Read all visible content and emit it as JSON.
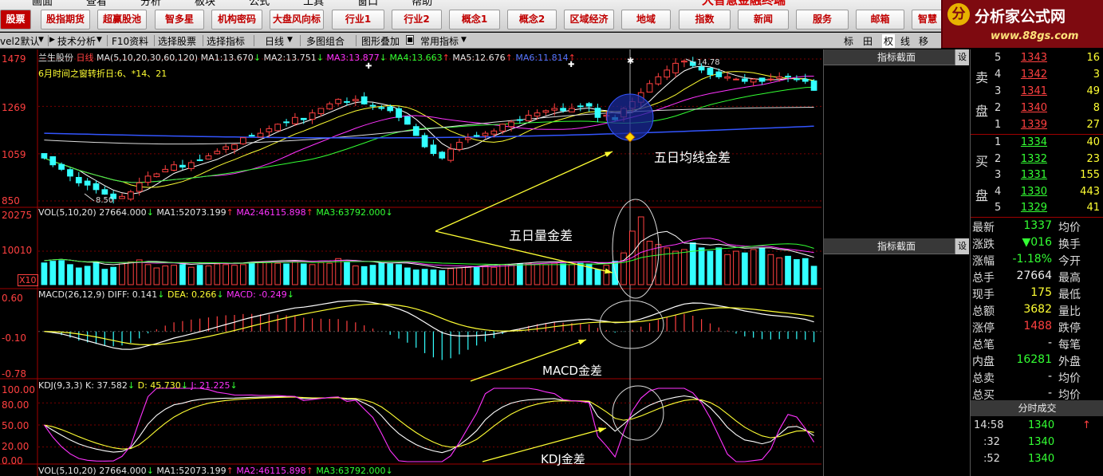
{
  "top_menu": [
    "画面",
    "查看",
    "分析",
    "板块",
    "公式",
    "工具",
    "窗口",
    "帮助"
  ],
  "banner": "大智慧金融终端",
  "top_buttons": [
    "股票",
    "股指期货",
    "超赢股池",
    "智多星",
    "机构密码",
    "大盘风向标",
    "行业1",
    "行业2",
    "概念1",
    "概念2",
    "区域经济",
    "地域",
    "指数",
    "新闻",
    "服务",
    "邮箱",
    "智慧"
  ],
  "logo": {
    "emblem": "分",
    "title": "分析家公式网",
    "url": "www.88gs.com"
  },
  "toolbar": {
    "level": "vel2默认",
    "items": [
      "技术分析",
      "F10资料",
      "选择股票",
      "选择指标",
      "日线",
      "多图组合",
      "图形叠加",
      "常用指标"
    ],
    "right_icons": [
      "标",
      "田",
      "权",
      "线",
      "移"
    ]
  },
  "price_panel": {
    "stock": "兰生股份",
    "period": "日线",
    "ma_formula": "MA(5,10,20,30,60,120)",
    "ma_values": [
      {
        "name": "MA1:",
        "value": "13.670",
        "dir": "↓"
      },
      {
        "name": "MA2:",
        "value": "13.751",
        "dir": "↓"
      },
      {
        "name": "MA3:",
        "value": "13.877",
        "dir": "↓"
      },
      {
        "name": "MA4:",
        "value": "13.663",
        "dir": "↑"
      },
      {
        "name": "MA5:",
        "value": "12.676",
        "dir": "↑"
      },
      {
        "name": "MA6:",
        "value": "11.814",
        "dir": "↑"
      }
    ],
    "turning_text": "6月时间之窗转折日:6、*14、21",
    "y_labels": [
      "1479",
      "1269",
      "1059",
      "850"
    ],
    "low_label": "8.50",
    "high_label": "14.78"
  },
  "volume_panel": {
    "formula": "VOL(5,10,20)",
    "vol_value": "27664.000",
    "ma_values": [
      {
        "name": "MA1:",
        "value": "52073.199",
        "dir": "↑"
      },
      {
        "name": "MA2:",
        "value": "46115.898",
        "dir": "↑"
      },
      {
        "name": "MA3:",
        "value": "63792.000",
        "dir": "↓"
      }
    ],
    "y_labels": [
      "20275",
      "10010",
      "X10"
    ]
  },
  "macd_panel": {
    "formula": "MACD(26,12,9)",
    "diff": "DIFF: 0.141",
    "dea": "DEA: 0.266",
    "macd": "MACD: -0.249",
    "y_labels": [
      "0.60",
      "-0.10",
      "-0.78"
    ]
  },
  "kdj_panel": {
    "formula": "KDJ(9,3,3)",
    "k": "K: 37.582",
    "d": "D: 45.730",
    "j": "J: 21.225",
    "y_labels": [
      "100.00",
      "80.00",
      "50.00",
      "20.00",
      "0.00"
    ]
  },
  "bottom_panel": {
    "formula": "VOL(5,10,20)",
    "vol_value": "27664.000",
    "ma_values": [
      {
        "name": "MA1:",
        "value": "52073.199",
        "dir": "↑"
      },
      {
        "name": "MA2:",
        "value": "46115.898",
        "dir": "↑"
      },
      {
        "name": "MA3:",
        "value": "63792.000",
        "dir": "↓"
      }
    ]
  },
  "annotations": [
    "五日均线金差",
    "五日量金差",
    "MACD金差",
    "KDJ金差"
  ],
  "indicator_panel": {
    "header": "指标截面",
    "settings": "设"
  },
  "orderbook": {
    "sell_label": [
      "卖",
      "盘"
    ],
    "buy_label": [
      "买",
      "盘"
    ],
    "sells": [
      {
        "level": "5",
        "price": "1343",
        "vol": "16"
      },
      {
        "level": "4",
        "price": "1342",
        "vol": "3"
      },
      {
        "level": "3",
        "price": "1341",
        "vol": "49"
      },
      {
        "level": "2",
        "price": "1340",
        "vol": "8"
      },
      {
        "level": "1",
        "price": "1339",
        "vol": "27"
      }
    ],
    "buys": [
      {
        "level": "1",
        "price": "1334",
        "vol": "40"
      },
      {
        "level": "2",
        "price": "1332",
        "vol": "23"
      },
      {
        "level": "3",
        "price": "1331",
        "vol": "155"
      },
      {
        "level": "4",
        "price": "1330",
        "vol": "443"
      },
      {
        "level": "5",
        "price": "1329",
        "vol": "41"
      }
    ]
  },
  "quote": [
    {
      "label": "最新",
      "value": "1337",
      "color": "green",
      "right": "均价"
    },
    {
      "label": "涨跌",
      "value": "▼016",
      "color": "green",
      "right": "换手"
    },
    {
      "label": "涨幅",
      "value": "-1.18%",
      "color": "green",
      "right": "今开"
    },
    {
      "label": "总手",
      "value": "27664",
      "color": "white",
      "right": "最高"
    },
    {
      "label": "现手",
      "value": "175",
      "color": "yellow",
      "right": "最低"
    },
    {
      "label": "总额",
      "value": "3682",
      "color": "yellow",
      "right": "量比"
    },
    {
      "label": "涨停",
      "value": "1488",
      "color": "red",
      "right": "跌停"
    },
    {
      "label": "总笔",
      "value": "-",
      "color": "white",
      "right": "每笔"
    },
    {
      "label": "内盘",
      "value": "16281",
      "color": "green",
      "right": "外盘"
    },
    {
      "label": "总卖",
      "value": "-",
      "color": "white",
      "right": "均价"
    },
    {
      "label": "总买",
      "value": "-",
      "color": "white",
      "right": "均价"
    }
  ],
  "trades": {
    "header": "分时成交",
    "rows": [
      {
        "time": "14:58",
        "price": "1340",
        "vol": "↑"
      },
      {
        "time": ":32",
        "price": "1340",
        "vol": ""
      },
      {
        "time": ":52",
        "price": "1340",
        "vol": ""
      }
    ]
  },
  "chart_data": [
    {
      "type": "candlestick",
      "title": "兰生股份 日线",
      "ylim": [
        8.5,
        14.79
      ],
      "y_ticks": [
        8.5,
        10.59,
        12.69,
        14.79
      ],
      "close": [
        10.4,
        10.1,
        9.9,
        9.6,
        9.3,
        9.2,
        9.0,
        8.8,
        8.6,
        8.7,
        8.9,
        9.3,
        9.6,
        9.7,
        9.9,
        10.1,
        10.0,
        10.2,
        10.3,
        10.5,
        10.7,
        10.9,
        11.0,
        11.3,
        11.4,
        11.5,
        11.7,
        11.9,
        12.0,
        12.2,
        12.1,
        12.4,
        12.6,
        12.8,
        13.0,
        12.9,
        13.0,
        12.8,
        12.7,
        12.6,
        12.5,
        12.2,
        11.9,
        11.4,
        10.9,
        10.6,
        10.4,
        10.8,
        11.1,
        11.3,
        11.4,
        11.5,
        11.6,
        11.9,
        12.0,
        12.1,
        12.3,
        12.4,
        12.5,
        12.6,
        12.5,
        12.6,
        12.7,
        12.7,
        12.2,
        12.3,
        12.1,
        12.6,
        12.9,
        13.3,
        13.7,
        14.0,
        14.3,
        14.6,
        14.7,
        14.5,
        14.3,
        14.1,
        14.0,
        14.0,
        13.9,
        13.8,
        13.9,
        13.8,
        13.9,
        14.0,
        14.0,
        13.9,
        13.8,
        13.4
      ],
      "ma5_last": 13.67,
      "ma10_last": 13.751,
      "ma20_last": 13.877,
      "ma30_last": 13.663,
      "ma60_last": 12.676,
      "ma120_last": 11.814,
      "low": 8.5,
      "high": 14.78
    },
    {
      "type": "bar",
      "title": "VOL(5,10,20)",
      "ylim": [
        0,
        20275
      ],
      "values": [
        6500,
        7000,
        7200,
        6000,
        5000,
        5500,
        6800,
        4600,
        5200,
        6200,
        6800,
        7400,
        6000,
        5000,
        5600,
        5800,
        6000,
        5200,
        5800,
        5600,
        6200,
        6000,
        5800,
        6000,
        6600,
        6800,
        6600,
        6400,
        6200,
        7000,
        6200,
        6000,
        6600,
        6400,
        7800,
        6600,
        5600,
        5400,
        5800,
        6400,
        6200,
        6000,
        5000,
        4400,
        4600,
        4400,
        4200,
        4800,
        5000,
        5200,
        5400,
        5600,
        5200,
        6000,
        5800,
        6200,
        6400,
        6200,
        6000,
        6400,
        6200,
        6000,
        6400,
        6200,
        4500,
        5800,
        7000,
        9500,
        16000,
        20275,
        13000,
        12000,
        11000,
        10000,
        10500,
        12500,
        11000,
        10000,
        11000,
        9000,
        10000,
        9500,
        10500,
        11000,
        9000,
        8000,
        8500,
        7500,
        7800,
        5500
      ],
      "ma1_last": 52073.199,
      "ma2_last": 46115.898,
      "ma3_last": 63792.0,
      "ma_display_ylim": [
        0,
        93000
      ]
    },
    {
      "type": "bar",
      "title": "MACD(26,12,9)",
      "ylim": [
        -0.78,
        0.6
      ],
      "diff_last": 0.141,
      "dea_last": 0.266,
      "macd_last": -0.249
    },
    {
      "type": "line",
      "title": "KDJ(9,3,3)",
      "ylim": [
        0,
        100
      ],
      "k_last": 37.582,
      "d_last": 45.73,
      "j_last": 21.225
    }
  ]
}
